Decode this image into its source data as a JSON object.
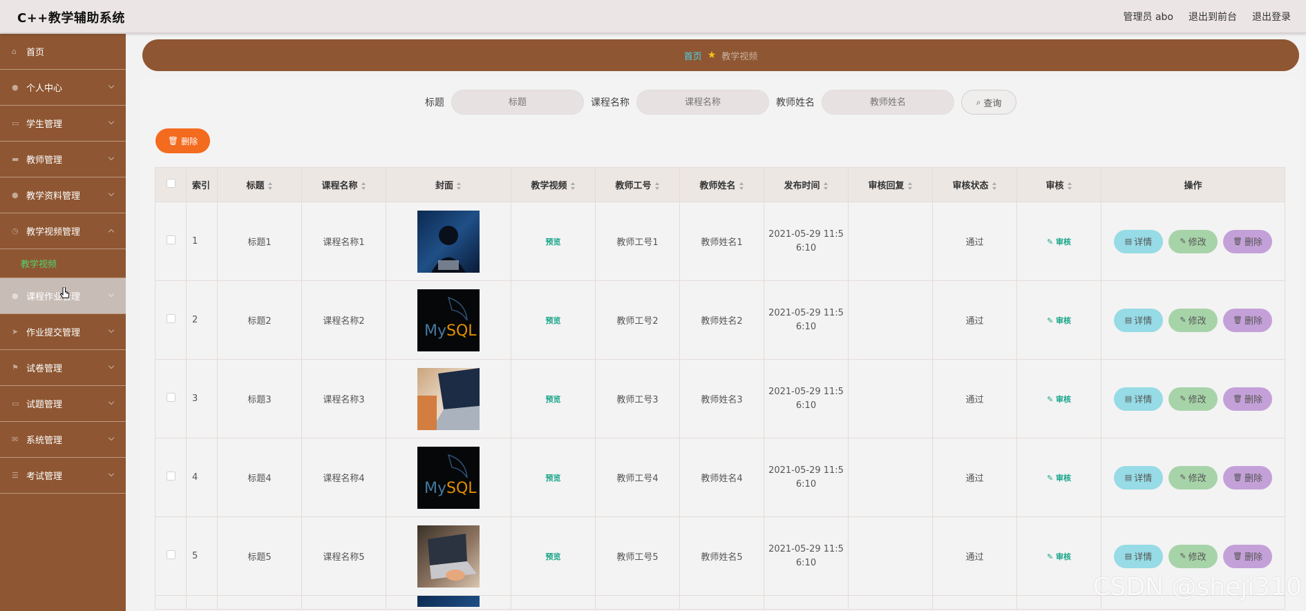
{
  "app": {
    "title": "C++教学辅助系统"
  },
  "header": {
    "user": "管理员 abo",
    "to_front": "退出到前台",
    "logout": "退出登录"
  },
  "sidebar": {
    "items": [
      {
        "label": "首页",
        "icon": "home-icon"
      },
      {
        "label": "个人中心",
        "icon": "user-icon"
      },
      {
        "label": "学生管理",
        "icon": "chat-icon"
      },
      {
        "label": "教师管理",
        "icon": "card-icon"
      },
      {
        "label": "教学资料管理",
        "icon": "user-icon"
      },
      {
        "label": "教学视频管理",
        "icon": "clock-icon",
        "expanded": true
      },
      {
        "label": "课程作业管理",
        "icon": "user-icon",
        "hovered": true
      },
      {
        "label": "作业提交管理",
        "icon": "send-icon"
      },
      {
        "label": "试卷管理",
        "icon": "flag-icon"
      },
      {
        "label": "试题管理",
        "icon": "screen-icon"
      },
      {
        "label": "系统管理",
        "icon": "mail-icon"
      },
      {
        "label": "考试管理",
        "icon": "sliders-icon"
      }
    ],
    "submenu": {
      "label": "教学视频"
    }
  },
  "breadcrumb": {
    "home": "首页",
    "current": "教学视频"
  },
  "search": {
    "title_label": "标题",
    "title_placeholder": "标题",
    "course_label": "课程名称",
    "course_placeholder": "课程名称",
    "teacher_label": "教师姓名",
    "teacher_placeholder": "教师姓名",
    "query_button": "查询"
  },
  "toolbar": {
    "delete_button": "删除"
  },
  "table": {
    "columns": [
      "索引",
      "标题",
      "课程名称",
      "封面",
      "教学视频",
      "教师工号",
      "教师姓名",
      "发布时间",
      "审核回复",
      "审核状态",
      "审核",
      "操作"
    ],
    "rows": [
      {
        "index": "1",
        "title": "标题1",
        "course": "课程名称1",
        "cover": "hacker",
        "video": "预览",
        "teacher_no": "教师工号1",
        "teacher_name": "教师姓名1",
        "time1": "2021-05-29 11:5",
        "time2": "6:10",
        "reply": "",
        "status": "通过",
        "audit": "审核"
      },
      {
        "index": "2",
        "title": "标题2",
        "course": "课程名称2",
        "cover": "mysql",
        "video": "预览",
        "teacher_no": "教师工号2",
        "teacher_name": "教师姓名2",
        "time1": "2021-05-29 11:5",
        "time2": "6:10",
        "reply": "",
        "status": "通过",
        "audit": "审核"
      },
      {
        "index": "3",
        "title": "标题3",
        "course": "课程名称3",
        "cover": "laptop",
        "video": "预览",
        "teacher_no": "教师工号3",
        "teacher_name": "教师姓名3",
        "time1": "2021-05-29 11:5",
        "time2": "6:10",
        "reply": "",
        "status": "通过",
        "audit": "审核"
      },
      {
        "index": "4",
        "title": "标题4",
        "course": "课程名称4",
        "cover": "mysql",
        "video": "预览",
        "teacher_no": "教师工号4",
        "teacher_name": "教师姓名4",
        "time1": "2021-05-29 11:5",
        "time2": "6:10",
        "reply": "",
        "status": "通过",
        "audit": "审核"
      },
      {
        "index": "5",
        "title": "标题5",
        "course": "课程名称5",
        "cover": "typing",
        "video": "预览",
        "teacher_no": "教师工号5",
        "teacher_name": "教师姓名5",
        "time1": "2021-05-29 11:5",
        "time2": "6:10",
        "reply": "",
        "status": "通过",
        "audit": "审核"
      }
    ],
    "actions": {
      "detail": "详情",
      "edit": "修改",
      "delete": "删除"
    }
  },
  "MySQL": {
    "my": "My",
    "sql": "SQL"
  },
  "watermark": "CSDN @sheji310",
  "colors": {
    "sidebar": "#8e5632",
    "accent_orange": "#f36b1e",
    "detail": "#96dbe5",
    "edit": "#a7d3a8",
    "delete": "#c4a0d8",
    "link_green": "#19a58a"
  }
}
